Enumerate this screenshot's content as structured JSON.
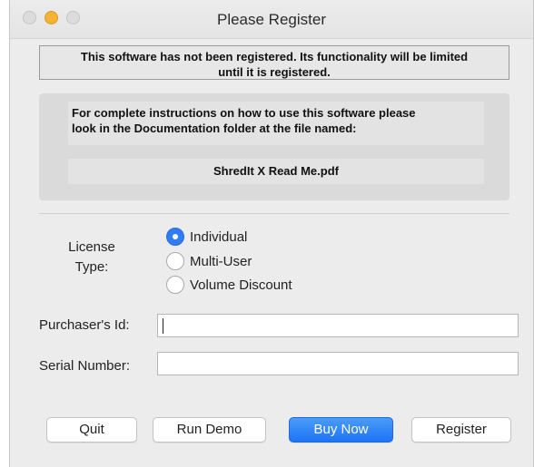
{
  "window": {
    "title": "Please Register"
  },
  "notice": {
    "line1": "This software has not been registered.  Its functionality will be limited",
    "line2": "until it is registered."
  },
  "info": {
    "line1": "For complete instructions on how to use this software please",
    "line2": "look in the Documentation folder at the file named:",
    "filename": "ShredIt X Read Me.pdf"
  },
  "license": {
    "label_line1": "License",
    "label_line2": "Type:",
    "options": [
      {
        "label": "Individual",
        "selected": true
      },
      {
        "label": "Multi-User",
        "selected": false
      },
      {
        "label": "Volume Discount",
        "selected": false
      }
    ]
  },
  "fields": {
    "purchaser_label": "Purchaser's Id:",
    "purchaser_value": "",
    "serial_label": "Serial Number:",
    "serial_value": ""
  },
  "buttons": {
    "quit": "Quit",
    "run_demo": "Run Demo",
    "buy_now": "Buy Now",
    "register": "Register"
  },
  "colors": {
    "accent": "#2f7cf6",
    "minimize": "#f5b335"
  }
}
